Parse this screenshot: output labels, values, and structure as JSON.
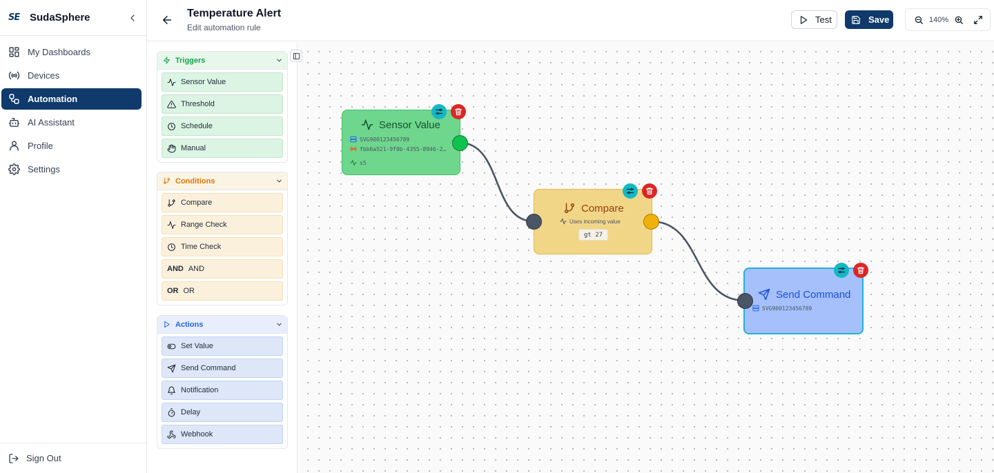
{
  "brand": {
    "logo": "SE",
    "name": "SudaSphere"
  },
  "nav": [
    {
      "label": "My Dashboards",
      "icon": "dashboard-icon"
    },
    {
      "label": "Devices",
      "icon": "radio-icon"
    },
    {
      "label": "Automation",
      "icon": "workflow-icon",
      "active": true
    },
    {
      "label": "AI Assistant",
      "icon": "bot-icon"
    },
    {
      "label": "Profile",
      "icon": "user-icon"
    },
    {
      "label": "Settings",
      "icon": "gear-icon"
    }
  ],
  "signout": "Sign Out",
  "header": {
    "title": "Temperature Alert",
    "subtitle": "Edit automation rule",
    "test_label": "Test",
    "save_label": "Save",
    "zoom": "140%"
  },
  "palette": {
    "triggers": {
      "label": "Triggers",
      "items": [
        "Sensor Value",
        "Threshold",
        "Schedule",
        "Manual"
      ]
    },
    "conditions": {
      "label": "Conditions",
      "items": [
        "Compare",
        "Range Check",
        "Time Check",
        "AND",
        "OR"
      ],
      "item_prefixes": {
        "AND": "AND",
        "OR": "OR"
      }
    },
    "actions": {
      "label": "Actions",
      "items": [
        "Set Value",
        "Send Command",
        "Notification",
        "Delay",
        "Webhook"
      ]
    }
  },
  "nodes": {
    "sensor": {
      "title": "Sensor Value",
      "device": "SVG900123456789",
      "sensor_id": "fbb6a521-9f0b-4355-8946-2…",
      "channel": "s5"
    },
    "compare": {
      "title": "Compare",
      "note": "Uses incoming value",
      "expression": "gt 27"
    },
    "command": {
      "title": "Send Command",
      "device": "SVG900123456789"
    }
  },
  "colors": {
    "brand": "#0f3a6b",
    "trigger": "#16a34a",
    "condition": "#d97706",
    "action": "#2563eb",
    "delete": "#dc2626",
    "config": "#14b8c4"
  }
}
